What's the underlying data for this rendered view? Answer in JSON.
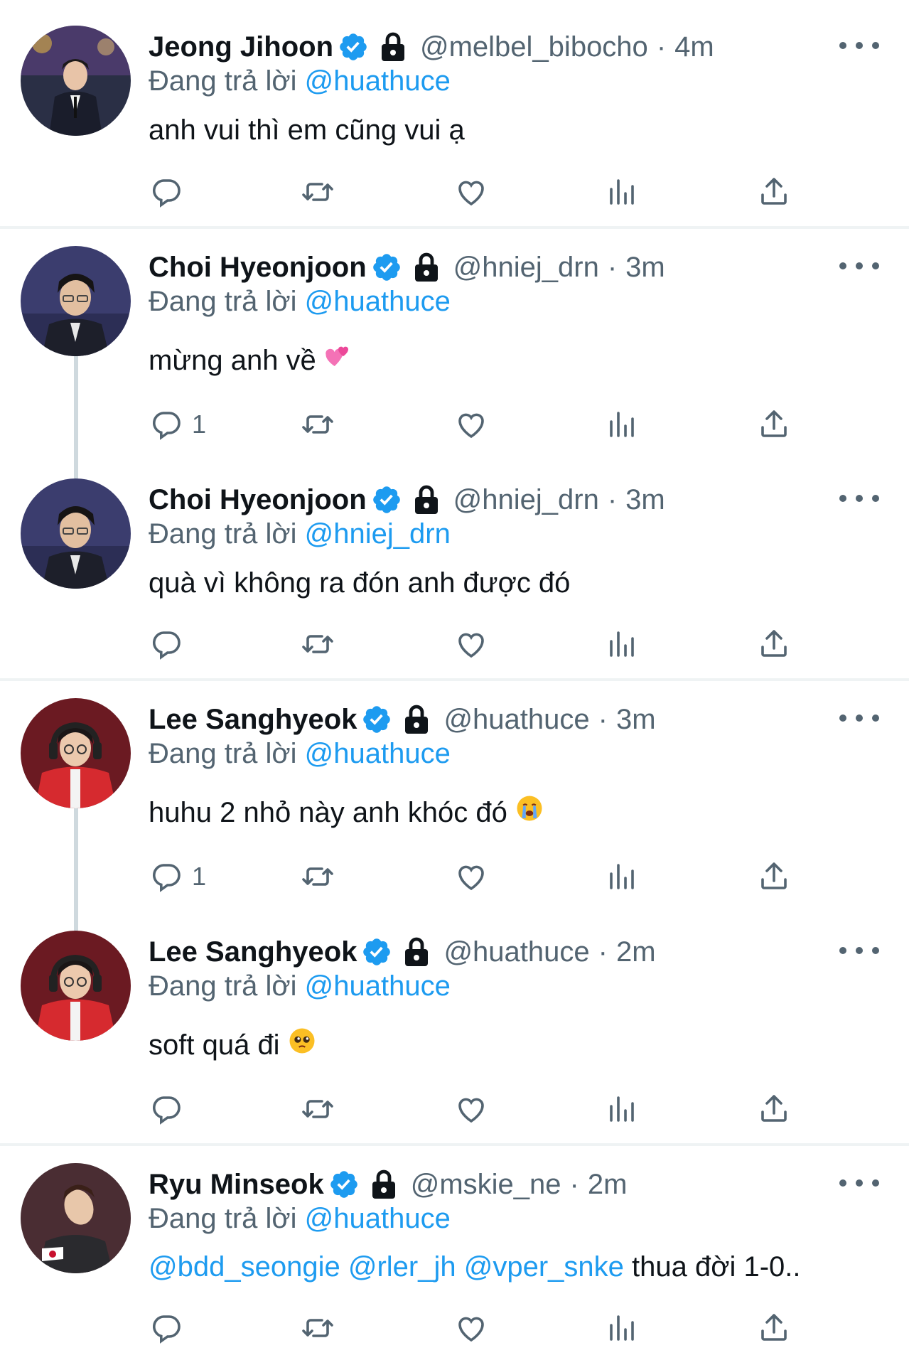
{
  "colors": {
    "accent": "#1d9bf0",
    "secondary_text": "#536471",
    "primary_text": "#0f1419",
    "divider": "#eff3f4"
  },
  "icons": {
    "verified": "verified-badge-icon",
    "lock": "lock-icon",
    "more": "more-icon",
    "reply": "reply-icon",
    "retweet": "retweet-icon",
    "like": "heart-icon",
    "views": "analytics-icon",
    "share": "share-icon"
  },
  "tweets": [
    {
      "name": "Jeong Jihoon",
      "handle": "@melbel_bibocho",
      "sep": "·",
      "time": "4m",
      "reply_prefix": "Đang trả lời",
      "reply_to": "@huathuce",
      "text": "anh vui thì em cũng vui ạ",
      "reply_count": ""
    },
    {
      "name": "Choi Hyeonjoon",
      "handle": "@hniej_drn",
      "sep": "·",
      "time": "3m",
      "reply_prefix": "Đang trả lời",
      "reply_to": "@huathuce",
      "text": "mừng anh về",
      "emoji": "two-hearts-emoji",
      "reply_count": "1"
    },
    {
      "name": "Choi Hyeonjoon",
      "handle": "@hniej_drn",
      "sep": "·",
      "time": "3m",
      "reply_prefix": "Đang trả lời",
      "reply_to": "@hniej_drn",
      "text": "quà vì không ra đón anh được đó",
      "reply_count": ""
    },
    {
      "name": "Lee Sanghyeok",
      "handle": "@huathuce",
      "sep": "·",
      "time": "3m",
      "reply_prefix": "Đang trả lời",
      "reply_to": "@huathuce",
      "text": "huhu 2 nhỏ này anh khóc đó",
      "emoji": "crying-face-emoji",
      "reply_count": "1"
    },
    {
      "name": "Lee Sanghyeok",
      "handle": "@huathuce",
      "sep": "·",
      "time": "2m",
      "reply_prefix": "Đang trả lời",
      "reply_to": "@huathuce",
      "text": "soft quá đi",
      "emoji": "pleading-face-emoji",
      "reply_count": ""
    },
    {
      "name": "Ryu Minseok",
      "handle": "@mskie_ne",
      "sep": "·",
      "time": "2m",
      "reply_prefix": "Đang trả lời",
      "reply_to": "@huathuce",
      "mentions": [
        "@bdd_seongie",
        "@rler_jh",
        "@vper_snke"
      ],
      "text": "thua đời 1-0..",
      "reply_count": ""
    }
  ]
}
